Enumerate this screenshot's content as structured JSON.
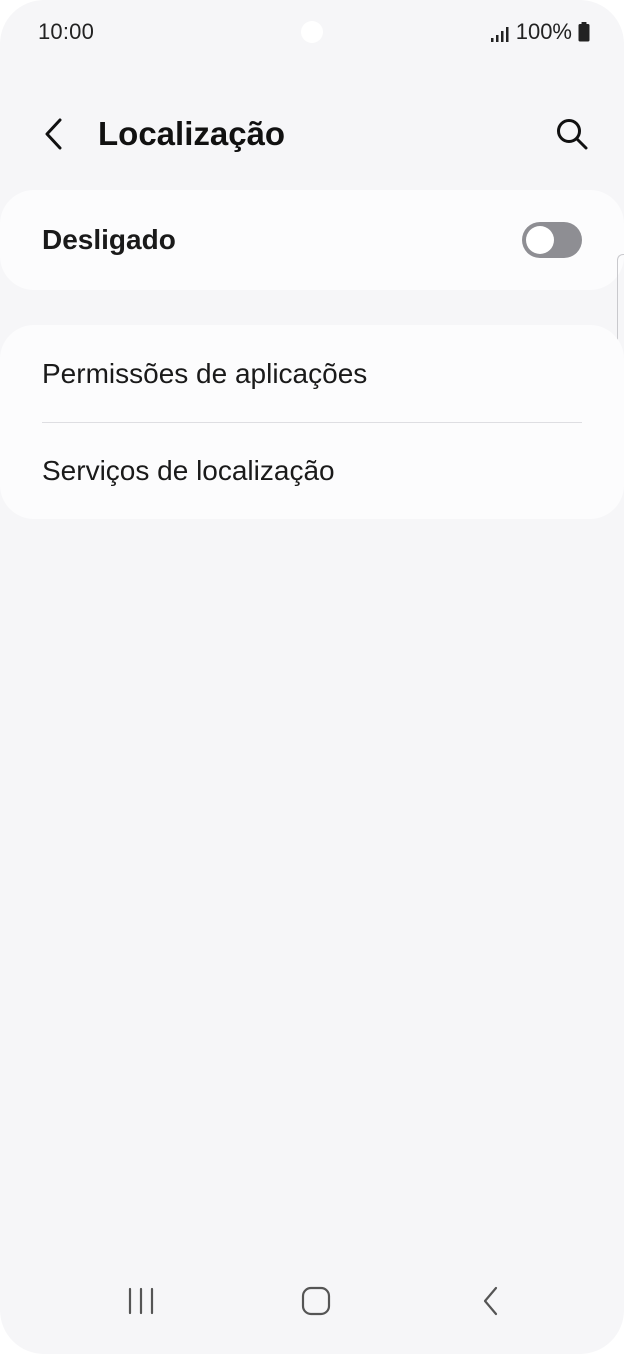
{
  "status_bar": {
    "time": "10:00",
    "battery_text": "100%",
    "icons": [
      "signal-icon",
      "battery-icon"
    ]
  },
  "header": {
    "title": "Localização",
    "back_icon": "chevron-left-icon",
    "search_icon": "search-icon"
  },
  "location_master": {
    "label": "Desligado",
    "enabled": false
  },
  "options": {
    "items": [
      {
        "label": "Permissões de aplicações"
      },
      {
        "label": "Serviços de localização"
      }
    ]
  },
  "nav_bar": {
    "icons": [
      "recents-icon",
      "home-icon",
      "back-icon"
    ]
  },
  "colors": {
    "background": "#f6f6f8",
    "card": "#fcfcfd",
    "toggle_off": "#8e8e93",
    "text": "#111111"
  }
}
